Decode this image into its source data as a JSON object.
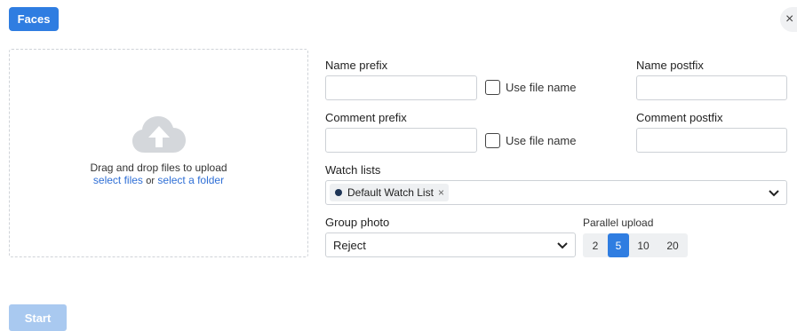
{
  "header": {
    "tab_label": "Faces",
    "close_glyph": "×"
  },
  "dropzone": {
    "icon": "cloud-upload-icon",
    "instruction": "Drag and drop files to upload",
    "select_files": "select files",
    "or_text": "or",
    "select_folder": "select a folder"
  },
  "form": {
    "name_prefix": {
      "label": "Name prefix",
      "value": "",
      "use_file_name_label": "Use file name",
      "use_file_name_checked": false
    },
    "name_postfix": {
      "label": "Name postfix",
      "value": ""
    },
    "comment_prefix": {
      "label": "Comment prefix",
      "value": "",
      "use_file_name_label": "Use file name",
      "use_file_name_checked": false
    },
    "comment_postfix": {
      "label": "Comment postfix",
      "value": ""
    },
    "watch_lists": {
      "label": "Watch lists",
      "selected": [
        {
          "name": "Default Watch List",
          "color": "#1e3556"
        }
      ],
      "remove_glyph": "×"
    },
    "group_photo": {
      "label": "Group photo",
      "value": "Reject"
    },
    "parallel_upload": {
      "label": "Parallel upload",
      "options": [
        "2",
        "5",
        "10",
        "20"
      ],
      "selected": "5"
    }
  },
  "footer": {
    "start_label": "Start"
  },
  "colors": {
    "accent": "#2f7de1",
    "disabled_accent": "#a9c9f0",
    "link": "#2f6fd6"
  }
}
